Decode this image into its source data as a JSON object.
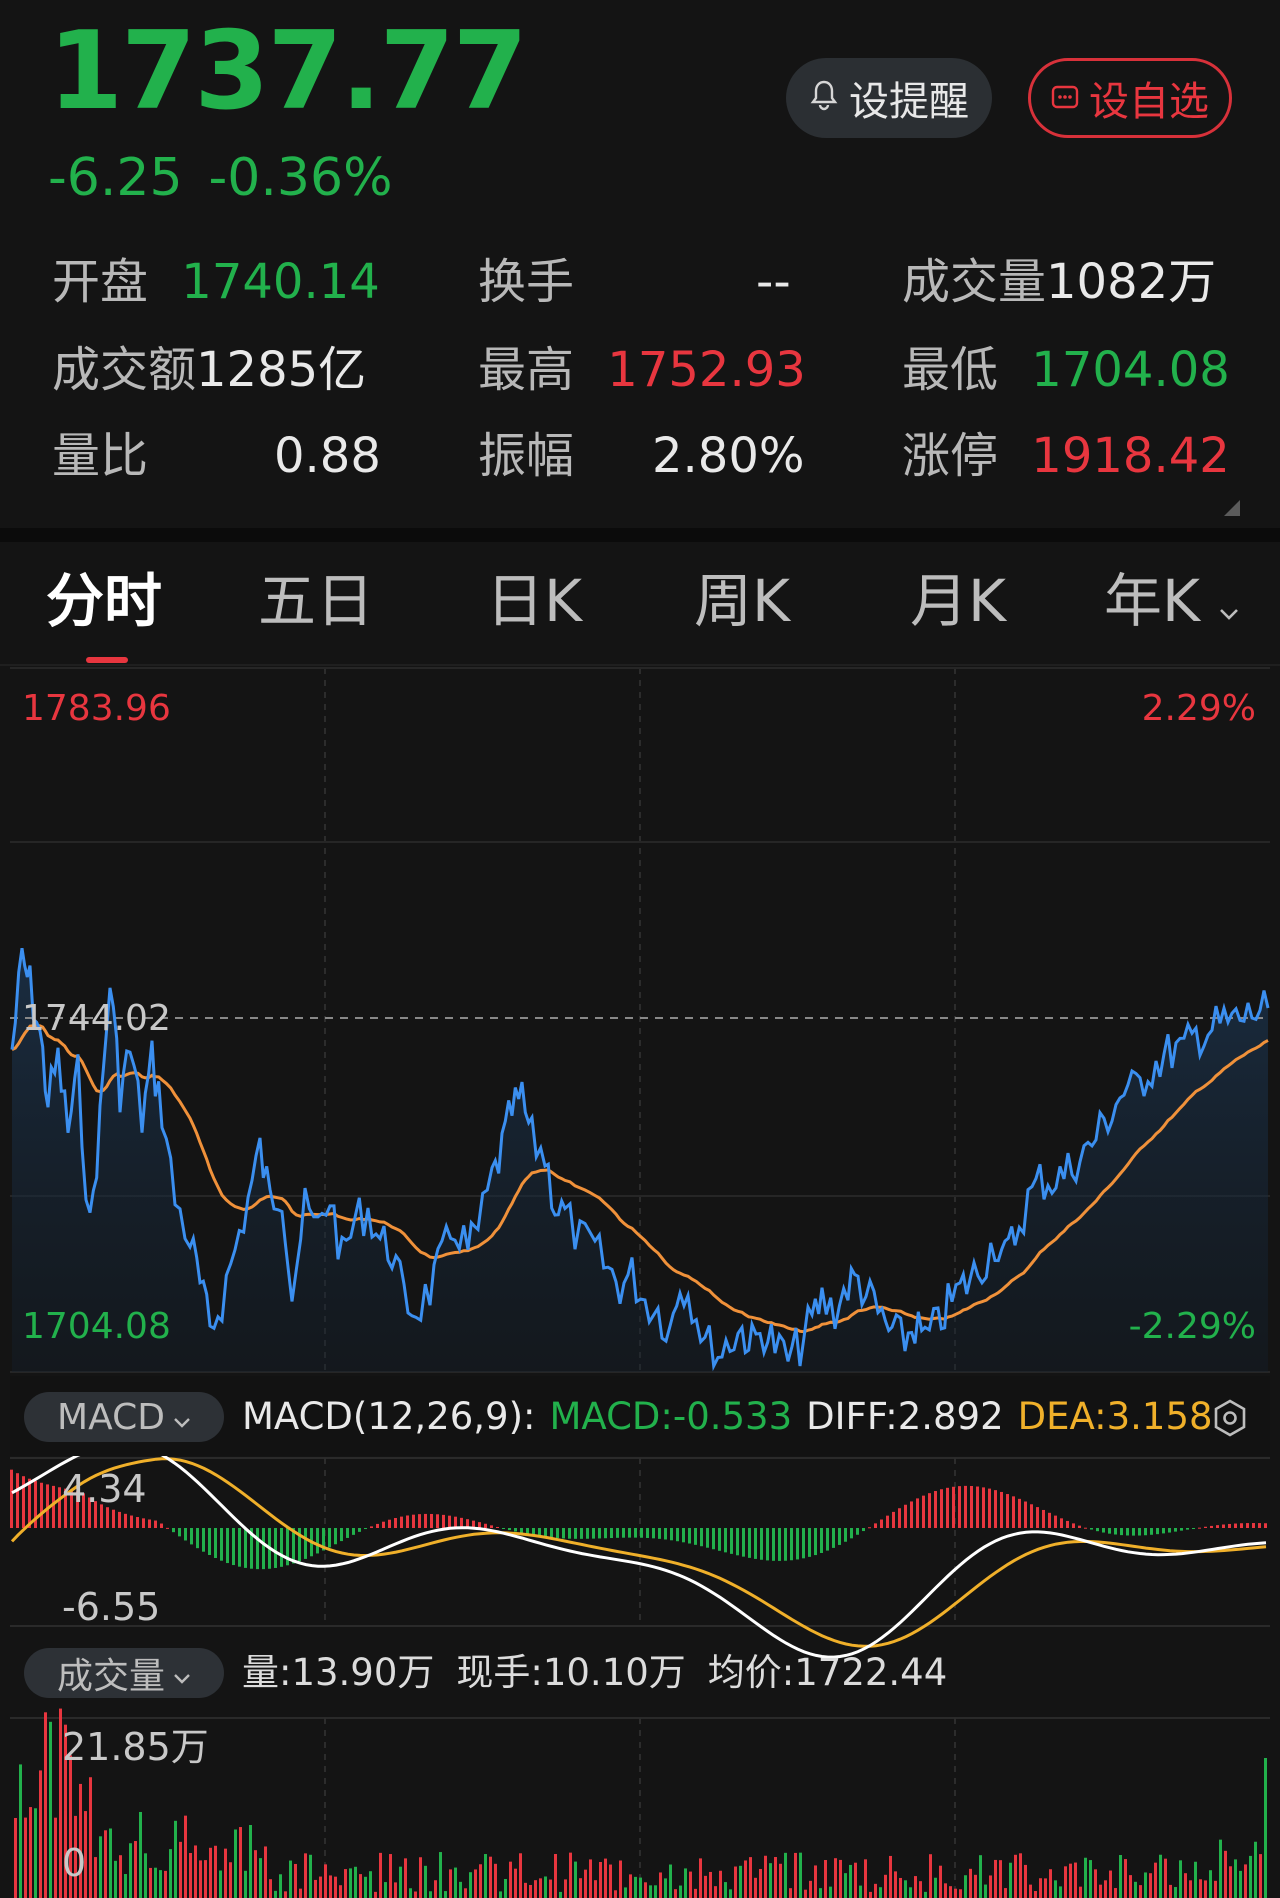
{
  "header": {
    "price": "1737.77",
    "change": "-6.25",
    "change_pct": "-0.36%",
    "alert_label": "设提醒",
    "watch_label": "设自选"
  },
  "stats": {
    "open_label": "开盘",
    "open_value": "1740.14",
    "turnover_label": "换手",
    "turnover_value": "--",
    "volume_label": "成交量",
    "volume_value": "1082万",
    "amount_label": "成交额",
    "amount_value": "1285亿",
    "high_label": "最高",
    "high_value": "1752.93",
    "low_label": "最低",
    "low_value": "1704.08",
    "ratio_label": "量比",
    "ratio_value": "0.88",
    "amplitude_label": "振幅",
    "amplitude_value": "2.80%",
    "limit_up_label": "涨停",
    "limit_up_value": "1918.42"
  },
  "tabs": [
    "分时",
    "五日",
    "日K",
    "周K",
    "月K",
    "年K"
  ],
  "active_tab": "分时",
  "chart": {
    "top_price": "1783.96",
    "top_pct": "2.29%",
    "base_price": "1744.02",
    "bottom_price": "1704.08",
    "bottom_pct": "-2.29%"
  },
  "macd": {
    "selector_label": "MACD",
    "params": "MACD(12,26,9):",
    "macd_value": "MACD:-0.533",
    "diff_value": "DIFF:2.892",
    "dea_value": "DEA:3.158",
    "axis_top": "4.34",
    "axis_bottom": "-6.55"
  },
  "volume": {
    "selector_label": "成交量",
    "vol_value": "量:13.90万",
    "current_hand": "现手:10.10万",
    "avg_price": "均价:1722.44",
    "axis_top": "21.85万",
    "axis_bottom": "0"
  },
  "colors": {
    "up": "#e8363f",
    "down": "#22b14c",
    "price_line": "#3b8ff0",
    "avg_line": "#f0913a",
    "dea_line": "#f0b02a",
    "diff_line": "#ffffff"
  }
}
